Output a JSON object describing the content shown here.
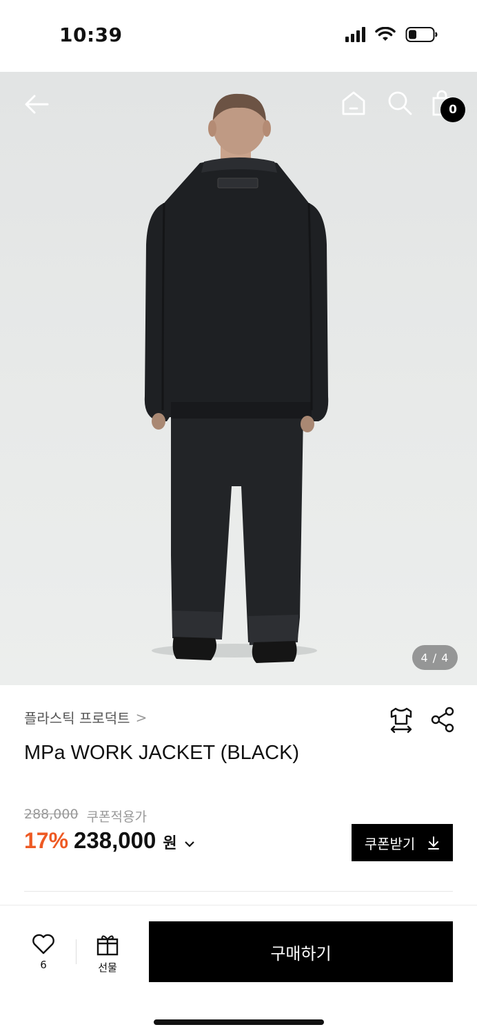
{
  "status_bar": {
    "time": "10:39"
  },
  "hero": {
    "cart_count": "0",
    "image_counter": "4 / 4"
  },
  "product": {
    "brand": "플라스틱 프로덕트",
    "brand_chevron": ">",
    "title": "MPa WORK JACKET (BLACK)",
    "original_price": "288,000",
    "coupon_note": "쿠폰적용가",
    "discount": "17%",
    "price": "238,000",
    "currency": "원",
    "price_chevron": "⌄"
  },
  "coupon_button": {
    "label": "쿠폰받기"
  },
  "bottom_bar": {
    "like_count": "6",
    "gift_label": "선물",
    "buy_label": "구매하기"
  },
  "colors": {
    "accent": "#ee5a24",
    "primary": "#000000",
    "hero_bg": "#e6e8e7"
  }
}
